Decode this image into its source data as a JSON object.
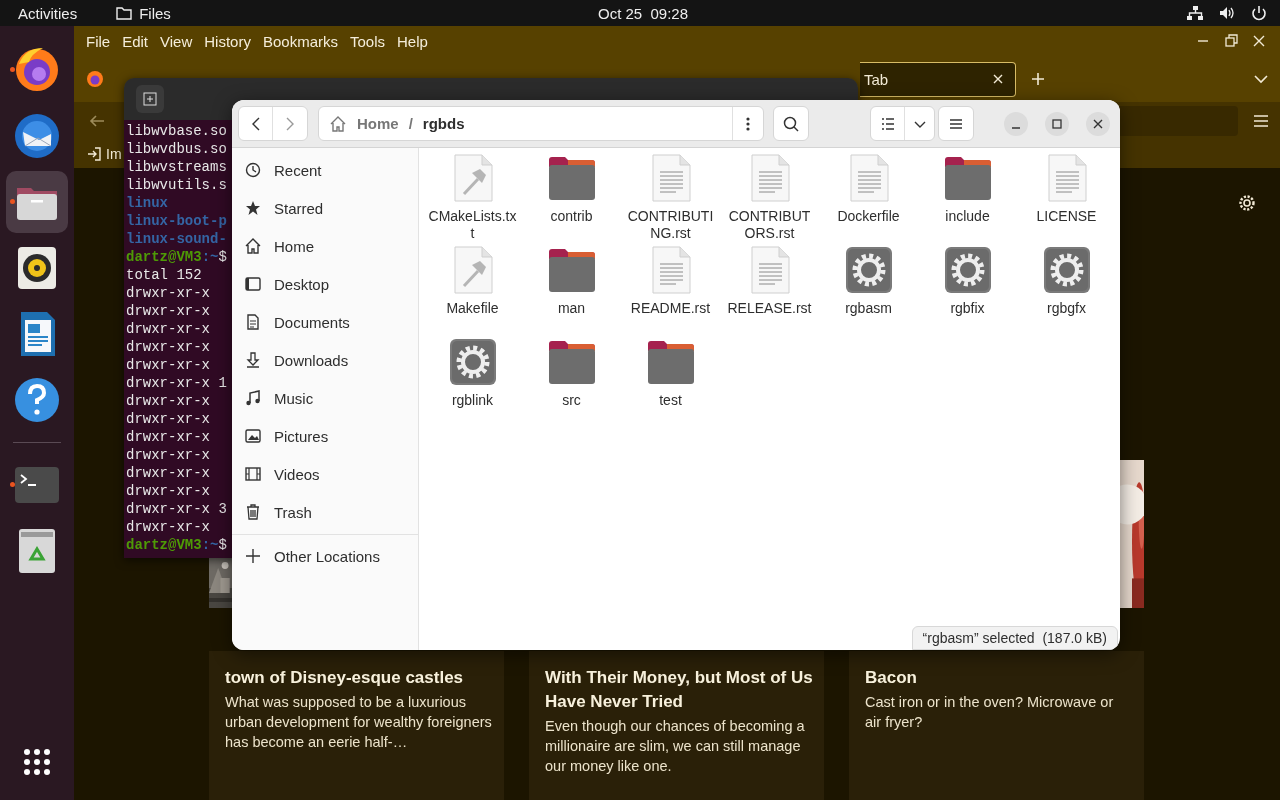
{
  "top_bar": {
    "activities": "Activities",
    "app": "Files",
    "clock": "Oct 25  09:28"
  },
  "dock": {
    "items": [
      {
        "kind": "browser",
        "running": true,
        "focused": false
      },
      {
        "kind": "mail",
        "running": false,
        "focused": false
      },
      {
        "kind": "files",
        "running": true,
        "focused": true
      },
      {
        "kind": "music",
        "running": false,
        "focused": false
      },
      {
        "kind": "writer",
        "running": false,
        "focused": false
      },
      {
        "kind": "help",
        "running": false,
        "focused": false
      },
      {
        "kind": "separator"
      },
      {
        "kind": "terminal",
        "running": true,
        "focused": false
      },
      {
        "kind": "trash",
        "running": false,
        "focused": false
      },
      {
        "kind": "apps"
      }
    ]
  },
  "browser": {
    "menu": [
      "File",
      "Edit",
      "View",
      "History",
      "Bookmarks",
      "Tools",
      "Help"
    ],
    "tab": {
      "label": "Tab",
      "selected": true
    },
    "bookmark": {
      "label": "Im"
    },
    "cards": [
      {
        "title": "town of Disney-esque castles",
        "text": "What was supposed to be a luxurious urban development for wealthy foreigners has become an eerie half-…"
      },
      {
        "title": "With Their Money, but Most of Us Have Never Tried",
        "text": "Even though our chances of becoming a millionaire are slim, we can still manage our money like one."
      },
      {
        "title": "Bacon",
        "text": "Cast iron or in the oven? Microwave or air fryer?"
      }
    ]
  },
  "terminal": {
    "lines": [
      {
        "kind": "plain",
        "text": "libwvbase.so"
      },
      {
        "kind": "plain",
        "text": "libwvdbus.so"
      },
      {
        "kind": "plain",
        "text": "libwvstreams"
      },
      {
        "kind": "plain",
        "text": "libwvutils.s"
      },
      {
        "kind": "dir",
        "text": "linux"
      },
      {
        "kind": "dir",
        "text": "linux-boot-p"
      },
      {
        "kind": "dir",
        "text": "linux-sound-"
      },
      {
        "kind": "prompt",
        "user": "dartz@VM3",
        "path": ":~",
        "symbol": "$"
      },
      {
        "kind": "plain",
        "text": "total 152"
      },
      {
        "kind": "plain",
        "text": "drwxr-xr-x"
      },
      {
        "kind": "plain",
        "text": "drwxr-xr-x"
      },
      {
        "kind": "plain",
        "text": "drwxr-xr-x"
      },
      {
        "kind": "plain",
        "text": "drwxr-xr-x"
      },
      {
        "kind": "plain",
        "text": "drwxr-xr-x"
      },
      {
        "kind": "plain",
        "text": "drwxr-xr-x 1"
      },
      {
        "kind": "plain",
        "text": "drwxr-xr-x"
      },
      {
        "kind": "plain",
        "text": "drwxr-xr-x"
      },
      {
        "kind": "plain",
        "text": "drwxr-xr-x"
      },
      {
        "kind": "plain",
        "text": "drwxr-xr-x"
      },
      {
        "kind": "plain",
        "text": "drwxr-xr-x"
      },
      {
        "kind": "plain",
        "text": "drwxr-xr-x"
      },
      {
        "kind": "plain",
        "text": "drwxr-xr-x 3"
      },
      {
        "kind": "plain",
        "text": "drwxr-xr-x"
      },
      {
        "kind": "prompt",
        "user": "dartz@VM3",
        "path": ":~",
        "symbol": "$"
      }
    ]
  },
  "files": {
    "path": [
      "Home",
      "/",
      "rgbds"
    ],
    "sidebar": [
      {
        "kind": "recent",
        "label": "Recent",
        "selected": false
      },
      {
        "kind": "starred",
        "label": "Starred",
        "selected": false
      },
      {
        "kind": "home",
        "label": "Home",
        "selected": false
      },
      {
        "kind": "desktop",
        "label": "Desktop",
        "selected": false
      },
      {
        "kind": "documents",
        "label": "Documents",
        "selected": false
      },
      {
        "kind": "downloads",
        "label": "Downloads",
        "selected": false
      },
      {
        "kind": "music",
        "label": "Music",
        "selected": false
      },
      {
        "kind": "pictures",
        "label": "Pictures",
        "selected": false
      },
      {
        "kind": "videos",
        "label": "Videos",
        "selected": false
      },
      {
        "kind": "trash",
        "label": "Trash",
        "selected": false
      },
      {
        "kind": "other",
        "label": "Other Locations",
        "selected": false
      }
    ],
    "items": [
      {
        "kind": "build",
        "name": "CMakeLists.txt"
      },
      {
        "kind": "folder",
        "name": "contrib"
      },
      {
        "kind": "text",
        "name": "CONTRIBUTING.rst"
      },
      {
        "kind": "text",
        "name": "CONTRIBUTORS.rst"
      },
      {
        "kind": "text",
        "name": "Dockerfile"
      },
      {
        "kind": "folder",
        "name": "include"
      },
      {
        "kind": "text",
        "name": "LICENSE"
      },
      {
        "kind": "build",
        "name": "Makefile"
      },
      {
        "kind": "folder",
        "name": "man"
      },
      {
        "kind": "text",
        "name": "README.rst"
      },
      {
        "kind": "text",
        "name": "RELEASE.rst"
      },
      {
        "kind": "exec",
        "name": "rgbasm"
      },
      {
        "kind": "exec",
        "name": "rgbfix"
      },
      {
        "kind": "exec",
        "name": "rgbgfx"
      },
      {
        "kind": "exec",
        "name": "rgblink"
      },
      {
        "kind": "folder",
        "name": "src"
      },
      {
        "kind": "folder",
        "name": "test"
      }
    ],
    "status": "“rgbasm” selected  (187.0 kB)"
  }
}
